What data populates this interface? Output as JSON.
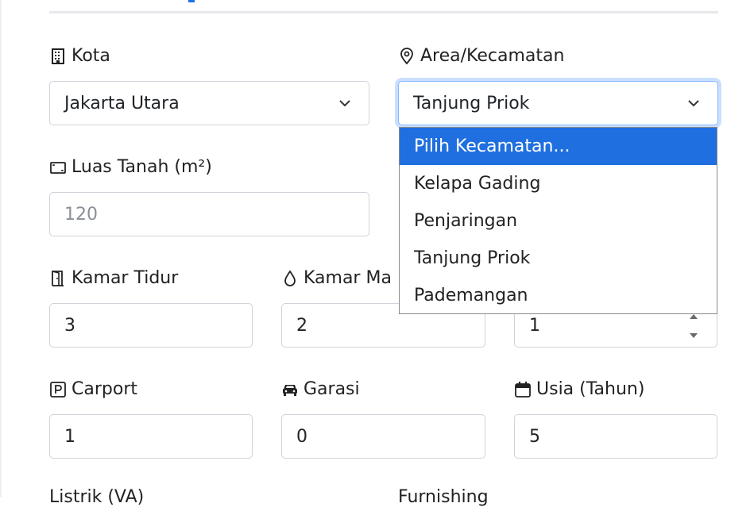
{
  "form": {
    "kota": {
      "label": "Kota",
      "value": "Jakarta Utara",
      "icon": "building-icon"
    },
    "area": {
      "label": "Area/Kecamatan",
      "value": "Tanjung Priok",
      "icon": "map-pin-icon"
    },
    "luas_tanah": {
      "label": "Luas Tanah (m²)",
      "placeholder": "120",
      "icon": "area-icon"
    },
    "kamar_tidur": {
      "label": "Kamar Tidur",
      "value": "3",
      "icon": "door-icon"
    },
    "kamar_mandi": {
      "label": "Kamar Ma",
      "value": "2",
      "icon": "droplet-icon"
    },
    "lantai": {
      "value": "1"
    },
    "carport": {
      "label": "Carport",
      "value": "1",
      "icon": "parking-icon"
    },
    "garasi": {
      "label": "Garasi",
      "value": "0",
      "icon": "car-icon"
    },
    "usia": {
      "label": "Usia (Tahun)",
      "value": "5",
      "icon": "calendar-icon"
    },
    "listrik": {
      "label": "Listrik (VA)"
    },
    "furnishing": {
      "label": "Furnishing"
    }
  },
  "dropdown": {
    "selected_index": 0,
    "options": [
      "Pilih Kecamatan...",
      "Kelapa Gading",
      "Penjaringan",
      "Tanjung Priok",
      "Pademangan"
    ]
  },
  "colors": {
    "accent": "#1f6fe0",
    "focus_ring": "#86b7fe",
    "border": "#ced4da"
  }
}
